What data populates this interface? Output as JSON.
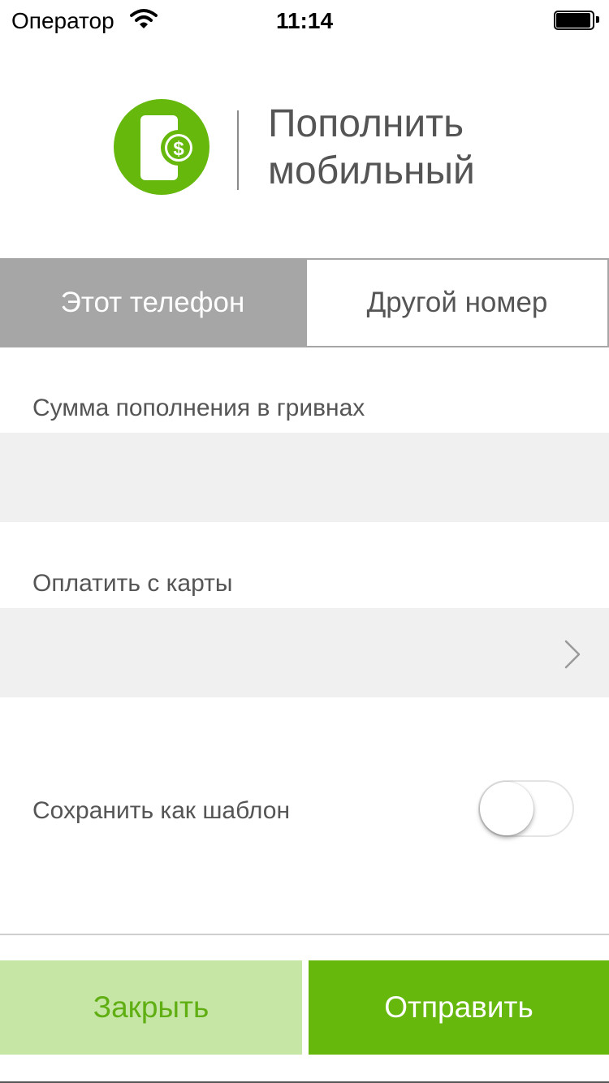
{
  "status_bar": {
    "carrier": "Оператор",
    "time": "11:14",
    "wifi_icon": "wifi-icon",
    "battery_icon": "battery-full-icon"
  },
  "header": {
    "icon": "mobile-topup-icon",
    "title_line1": "Пополнить",
    "title_line2": "мобильный"
  },
  "tabs": [
    {
      "label": "Этот телефон",
      "selected": true
    },
    {
      "label": "Другой номер",
      "selected": false
    }
  ],
  "amount_field": {
    "label": "Сумма пополнения в гривнах",
    "value": ""
  },
  "card_field": {
    "label": "Оплатить с карты",
    "value": "",
    "chevron_icon": "chevron-right-icon"
  },
  "save_template": {
    "label": "Сохранить как шаблон",
    "enabled": false
  },
  "buttons": {
    "close": "Закрыть",
    "send": "Отправить"
  },
  "colors": {
    "brand_green": "#66b80c",
    "brand_green_light": "#c5e6a5",
    "tab_active_bg": "#a6a6a6",
    "field_bg": "#f0f0f0"
  }
}
